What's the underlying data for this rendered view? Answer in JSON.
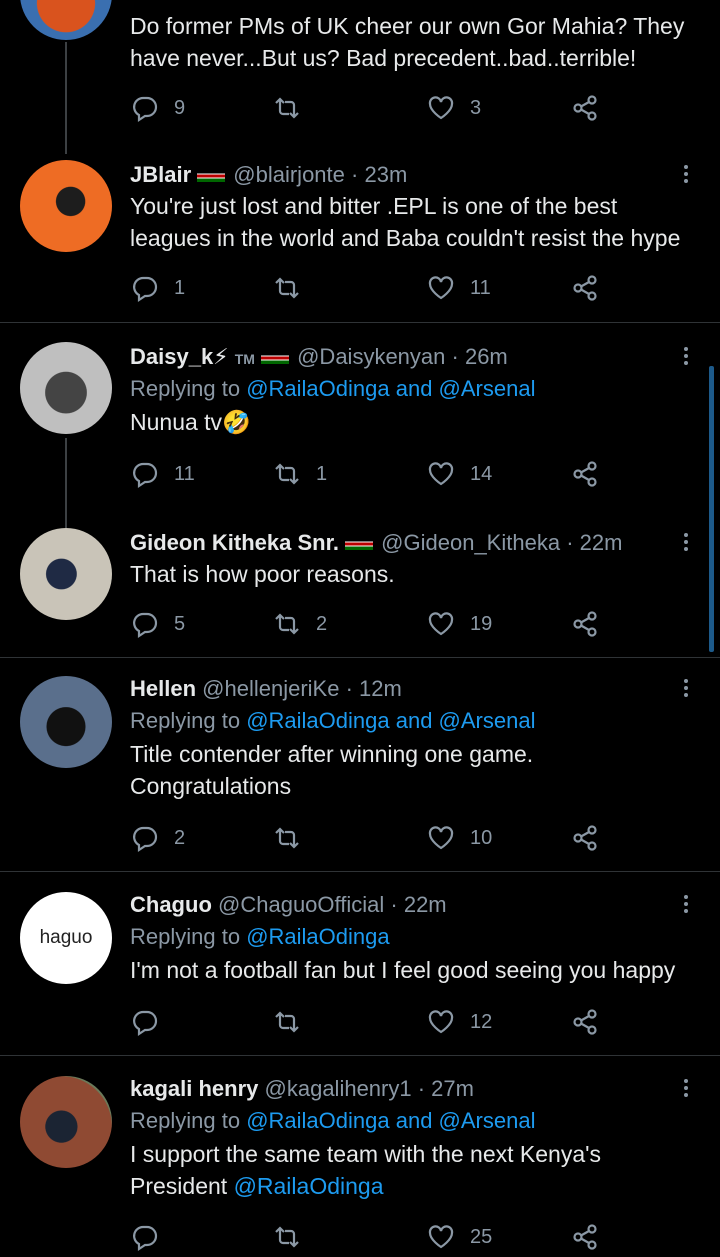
{
  "tweets": [
    {
      "name": "",
      "handle": "",
      "time": "",
      "reply_to": "",
      "text": [
        "Do former PMs of UK cheer our own Gor Mahia? They",
        "have never...But us? Bad precedent..bad..terrible!"
      ],
      "replies": "9",
      "retweets": "",
      "likes": "3"
    },
    {
      "name": "JBlair",
      "handle": "@blairjonte",
      "time": "· 23m",
      "reply_to": "",
      "text": [
        "You're just lost and bitter .EPL is one of the best",
        "leagues in the world and Baba couldn't resist the hype"
      ],
      "replies": "1",
      "retweets": "",
      "likes": "11"
    },
    {
      "name": "Daisy_k⚡",
      "name_suffix": "TM",
      "handle": "@Daisykenyan",
      "time": "· 26m",
      "reply_to_prefix": "Replying to",
      "reply_to": "@RailaOdinga and @Arsenal",
      "text": [
        "Nunua tv🤣"
      ],
      "replies": "11",
      "retweets": "1",
      "likes": "14"
    },
    {
      "name": "Gideon Kitheka Snr.",
      "handle": "@Gideon_Kitheka",
      "time": "· 22m",
      "reply_to": "",
      "text": [
        "That is how poor reasons."
      ],
      "replies": "5",
      "retweets": "2",
      "likes": "19"
    },
    {
      "name": "Hellen",
      "handle": "@hellenjeriKe",
      "time": "· 12m",
      "reply_to_prefix": "Replying to",
      "reply_to": "@RailaOdinga and @Arsenal",
      "text": [
        "Title contender after winning one game.",
        "Congratulations"
      ],
      "replies": "2",
      "retweets": "",
      "likes": "10"
    },
    {
      "name": "Chaguo",
      "handle": "@ChaguoOfficial",
      "time": "· 22m",
      "reply_to_prefix": "Replying to",
      "reply_to": "@RailaOdinga",
      "avatar_text": "haguo",
      "text": [
        "I'm not a football fan but I feel good seeing you happy"
      ],
      "replies": "",
      "retweets": "",
      "likes": "12"
    },
    {
      "name": "kagali henry",
      "handle": "@kagalihenry1",
      "time": "· 27m",
      "reply_to_prefix": "Replying to",
      "reply_to": "@RailaOdinga and @Arsenal",
      "text": [
        "I support the same team with the next Kenya's",
        "President"
      ],
      "text_mention": "@RailaOdinga",
      "replies": "",
      "retweets": "",
      "likes": "25"
    }
  ],
  "colors": {
    "background": "#000000",
    "text": "#e7e9ea",
    "muted": "#8b98a5",
    "link": "#1d9bf0",
    "divider": "#2f3336"
  },
  "icons": [
    "reply-icon",
    "retweet-icon",
    "like-icon",
    "share-icon",
    "more-icon"
  ]
}
